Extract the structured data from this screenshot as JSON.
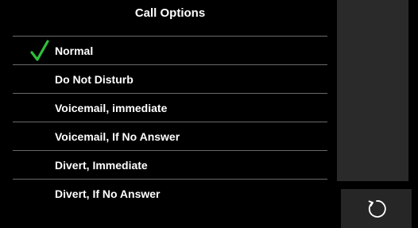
{
  "menu": {
    "title": "Call Options",
    "items": [
      {
        "label": "Normal",
        "selected": true
      },
      {
        "label": "Do Not Disturb",
        "selected": false
      },
      {
        "label": "Voicemail, immediate",
        "selected": false
      },
      {
        "label": "Voicemail, If No Answer",
        "selected": false
      },
      {
        "label": "Divert, Immediate",
        "selected": false
      },
      {
        "label": "Divert, If No Answer",
        "selected": false
      }
    ]
  },
  "icons": {
    "selected_marker": "checkmark-icon",
    "reset": "refresh-icon"
  },
  "colors": {
    "background": "#000000",
    "side_panel": "#2a2a2a",
    "divider": "#6a6a6a",
    "text": "#ffffff",
    "check": "#2fbf3a"
  }
}
